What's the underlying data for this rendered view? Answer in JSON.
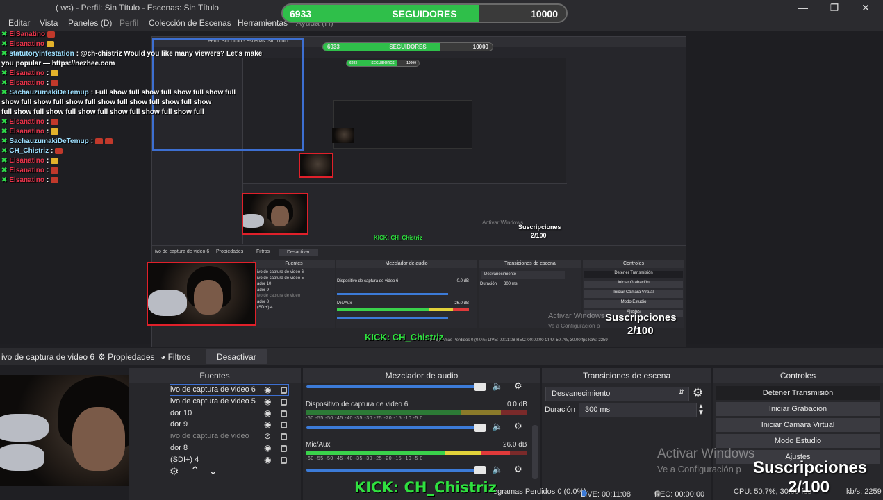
{
  "window": {
    "title": "(        ws) - Perfil: Sin Título - Escenas: Sin Título",
    "app_icon": "obs-icon"
  },
  "menu": [
    "Editar",
    "Vista",
    "Paneles (D)",
    "Perfil",
    "Colección de Escenas",
    "Herramientas",
    "Ayuda (H)"
  ],
  "followers": {
    "current": "6933",
    "label": "SEGUIDORES",
    "goal": "10000",
    "progress": 0.6933
  },
  "chat": {
    "messages": [
      {
        "user": "ElSanatino",
        "text": "",
        "emotes": 1,
        "kind": "mod"
      },
      {
        "user": "Elsanatino",
        "text": "",
        "emotes": 1,
        "kind": "mod"
      },
      {
        "user": "statutoryinfestation",
        "text": ": @ch-chistriz Would you like many viewers? Let's make",
        "emotes": 0,
        "kind": "bot"
      },
      {
        "user": "",
        "text": "you popular — https://nezhee.com",
        "emotes": 0,
        "kind": "cont"
      },
      {
        "user": "Elsanatino",
        "text": ":",
        "emotes": 1,
        "kind": "mod"
      },
      {
        "user": "Elsanatino",
        "text": ":",
        "emotes": 1,
        "kind": "mod"
      },
      {
        "user": "SachauzumakiDeTemup",
        "text": ": Full show full show full show full show full",
        "emotes": 0,
        "kind": "user"
      },
      {
        "user": "",
        "text": "show full show full show full show full show full show full show",
        "emotes": 0,
        "kind": "cont"
      },
      {
        "user": "",
        "text": "full show full show full show full show full show full show full",
        "emotes": 0,
        "kind": "cont"
      },
      {
        "user": "Elsanatino",
        "text": ":",
        "emotes": 1,
        "kind": "mod"
      },
      {
        "user": "Elsanatino",
        "text": ":",
        "emotes": 1,
        "kind": "mod"
      },
      {
        "user": "SachauzumakiDeTemup",
        "text": ":",
        "emotes": 2,
        "kind": "user"
      },
      {
        "user": "CH_Chistriz",
        "text": ":",
        "emotes": 1,
        "kind": "user"
      },
      {
        "user": "Elsanatino",
        "text": ":",
        "emotes": 1,
        "kind": "mod"
      },
      {
        "user": "Elsanatino",
        "text": ":",
        "emotes": 1,
        "kind": "mod"
      },
      {
        "user": "Elsanatino",
        "text": ":",
        "emotes": 1,
        "kind": "mod"
      }
    ]
  },
  "overlay": {
    "kick_text": "KICK: CH_Chistriz",
    "subs_label": "Suscripciones",
    "subs_count": "2/100",
    "activate_title": "Activar Windows",
    "activate_sub": "Ve a Configuración p"
  },
  "nested": {
    "title_1": "Perfil: Sin Título - Escenas: Sin Título",
    "followers_1": {
      "current": "6933",
      "label": "SEGUIDORES",
      "goal": "10000"
    },
    "followers_2": {
      "current": "6933",
      "label": "SEGUIDORES",
      "goal": "10000"
    },
    "source_name": "ivo de captura de video 6",
    "props": "Propiedades",
    "filters": "Filtros",
    "deactivate": "Desactivar",
    "fuentes": "Fuentes",
    "mixer": "Mezclador de audio",
    "transitions": "Transiciones de escena",
    "controls": "Controles",
    "device": "Dispositivo de captura de video 6",
    "mic": "Mic/Aux",
    "fade": "Desvanecimiento",
    "duration_label": "Duración",
    "duration": "300 ms",
    "btn_stop": "Detener Transmisión",
    "btn_record": "Iniciar Grabación",
    "btn_vcam": "Iniciar Cámara Virtual",
    "btn_studio": "Modo Estudio",
    "btn_settings": "Ajustes",
    "status": "Fotogramas Perdidos 0 (0.0%)   LIVE: 00:11:08   REC: 00:00:00   CPU: 50.7%, 30.00 fps   kb/s: 2259",
    "src_items": [
      "ivo de captura de video 6",
      "ivo de captura de video 5",
      "ador 10",
      "ador 9",
      "ivo de captura de video",
      "ador 8",
      "(SDI+) 4"
    ],
    "db1": "0.0 dB",
    "db2": "26.0 dB"
  },
  "toolbar": {
    "source_name": "ivo de captura de video 6",
    "properties": "Propiedades",
    "filters": "Filtros",
    "deactivate": "Desactivar"
  },
  "docks": {
    "sources": {
      "header": "Fuentes",
      "items": [
        {
          "name": "ivo de captura de video 6",
          "visible": true,
          "dim": false
        },
        {
          "name": "ivo de captura de video 5",
          "visible": true,
          "dim": false
        },
        {
          "name": "dor 10",
          "visible": true,
          "dim": false
        },
        {
          "name": "dor 9",
          "visible": true,
          "dim": false
        },
        {
          "name": "ivo de captura de video",
          "visible": false,
          "dim": true
        },
        {
          "name": "dor 8",
          "visible": true,
          "dim": false
        },
        {
          "name": "(SDI+) 4",
          "visible": true,
          "dim": false
        }
      ]
    },
    "mixer": {
      "header": "Mezclador de audio",
      "channels": [
        {
          "name": "Dispositivo de captura de video 6",
          "db": "0.0 dB",
          "level": 0.0
        },
        {
          "name": "Mic/Aux",
          "db": "26.0 dB",
          "level": 0.92
        }
      ],
      "ticks": "-60  -55  -50  -45  -40  -35  -30  -25  -20  -15  -10   -5    0"
    },
    "transitions": {
      "header": "Transiciones de escena",
      "selected": "Desvanecimiento",
      "duration_label": "Duración",
      "duration": "300 ms"
    },
    "controls": {
      "header": "Controles",
      "buttons": [
        "Detener Transmisión",
        "Iniciar Grabación",
        "Iniciar Cámara Virtual",
        "Modo Estudio",
        "Ajustes"
      ]
    }
  },
  "statusbar": {
    "dropped": "ogramas Perdidos 0 (0.0%)",
    "live": "LIVE: 00:11:08",
    "rec": "REC: 00:00:00",
    "cpu": "CPU: 50.7%, 30.00 fps",
    "kbs": "kb/s: 2259"
  },
  "colors": {
    "accent": "#2fbf4a",
    "kick": "#2fe03f",
    "selection": "#3d6fd1",
    "source_frame": "#e0202a",
    "slider": "#3c7bd8"
  }
}
